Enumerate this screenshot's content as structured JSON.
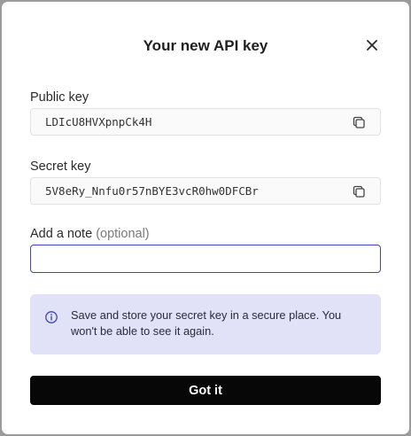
{
  "dialog": {
    "title": "Your new API key",
    "close_icon": "close-icon"
  },
  "public_key": {
    "label": "Public key",
    "value": "LDIcU8HVXpnpCk4H",
    "copy_icon": "copy-icon"
  },
  "secret_key": {
    "label": "Secret key",
    "value": "5V8eRy_Nnfu0r57nBYE3vcR0hw0DFCBr",
    "copy_icon": "copy-icon"
  },
  "note": {
    "label": "Add a note",
    "optional": "(optional)",
    "value": "",
    "placeholder": ""
  },
  "info": {
    "icon": "info-icon",
    "text": "Save and store your secret key in a secure place. You won't be able to see it again."
  },
  "confirm_button": {
    "label": "Got it"
  },
  "colors": {
    "accent": "#3f45b8",
    "info_bg": "#e1e1f7",
    "button_bg": "#070707",
    "overlay": "#9b9b9b"
  }
}
